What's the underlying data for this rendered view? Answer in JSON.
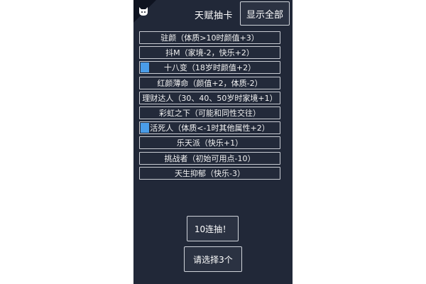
{
  "header": {
    "title": "天赋抽卡",
    "show_all_label": "显示全部",
    "corner_icon": "cat-icon"
  },
  "talents": [
    {
      "label": "驻颜（体质>10时颜值+3）",
      "selected": false
    },
    {
      "label": "抖M（家境-2，快乐+2）",
      "selected": false
    },
    {
      "label": "十八变（18岁时颜值+2）",
      "selected": true
    },
    {
      "label": "红颜薄命（颜值+2，体质-2）",
      "selected": false
    },
    {
      "label": "理财达人（30、40、50岁时家境+1）",
      "selected": false
    },
    {
      "label": "彩虹之下（可能和同性交往）",
      "selected": false
    },
    {
      "label": "活死人（体质<-1时其他属性+2）",
      "selected": true
    },
    {
      "label": "乐天派（快乐+1）",
      "selected": false
    },
    {
      "label": "挑战者（初始可用点-10）",
      "selected": false
    },
    {
      "label": "天生抑郁（快乐-3）",
      "selected": false
    }
  ],
  "actions": {
    "ten_draw_label": "10连抽！",
    "choose_label": "请选择3个"
  },
  "colors": {
    "background": "#212838",
    "accent": "#4a9ce8",
    "border": "#c9ccd3"
  }
}
